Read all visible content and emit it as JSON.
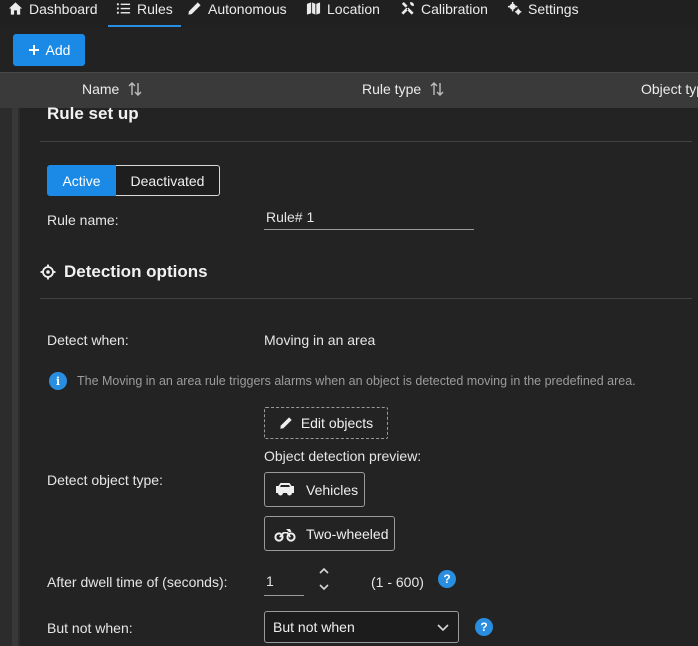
{
  "nav": {
    "items": [
      {
        "label": "Dashboard",
        "icon": "home-icon"
      },
      {
        "label": "Rules",
        "icon": "list-icon",
        "active": true
      },
      {
        "label": "Autonomous",
        "icon": "pencil-icon"
      },
      {
        "label": "Location",
        "icon": "map-icon"
      },
      {
        "label": "Calibration",
        "icon": "tools-icon"
      },
      {
        "label": "Settings",
        "icon": "gears-icon"
      }
    ]
  },
  "toolbar": {
    "add_label": "Add"
  },
  "table": {
    "headers": [
      "Name",
      "Rule type",
      "Object typ"
    ]
  },
  "setup": {
    "title": "Rule set up",
    "status": {
      "active_label": "Active",
      "inactive_label": "Deactivated",
      "selected": "Active"
    },
    "rule_name_label": "Rule name:",
    "rule_name_value": "Rule# 1"
  },
  "detection": {
    "title": "Detection options",
    "detect_when_label": "Detect when:",
    "detect_when_value": "Moving in an area",
    "info_text": "The Moving in an area rule triggers alarms when an object is detected moving in the predefined area.",
    "edit_objects_label": "Edit objects",
    "preview_label": "Object detection preview:",
    "object_type_label": "Detect object type:",
    "objects": [
      {
        "label": "Vehicles",
        "icon": "car-icon"
      },
      {
        "label": "Two-wheeled",
        "icon": "motorcycle-icon"
      }
    ],
    "dwell_label": "After dwell time of (seconds):",
    "dwell_value": "1",
    "dwell_range": "(1 - 600)",
    "but_not_label": "But not when:",
    "but_not_value": "But not when"
  },
  "colors": {
    "accent": "#1a8ae6",
    "background": "#232323",
    "header": "#3a3a3a"
  }
}
